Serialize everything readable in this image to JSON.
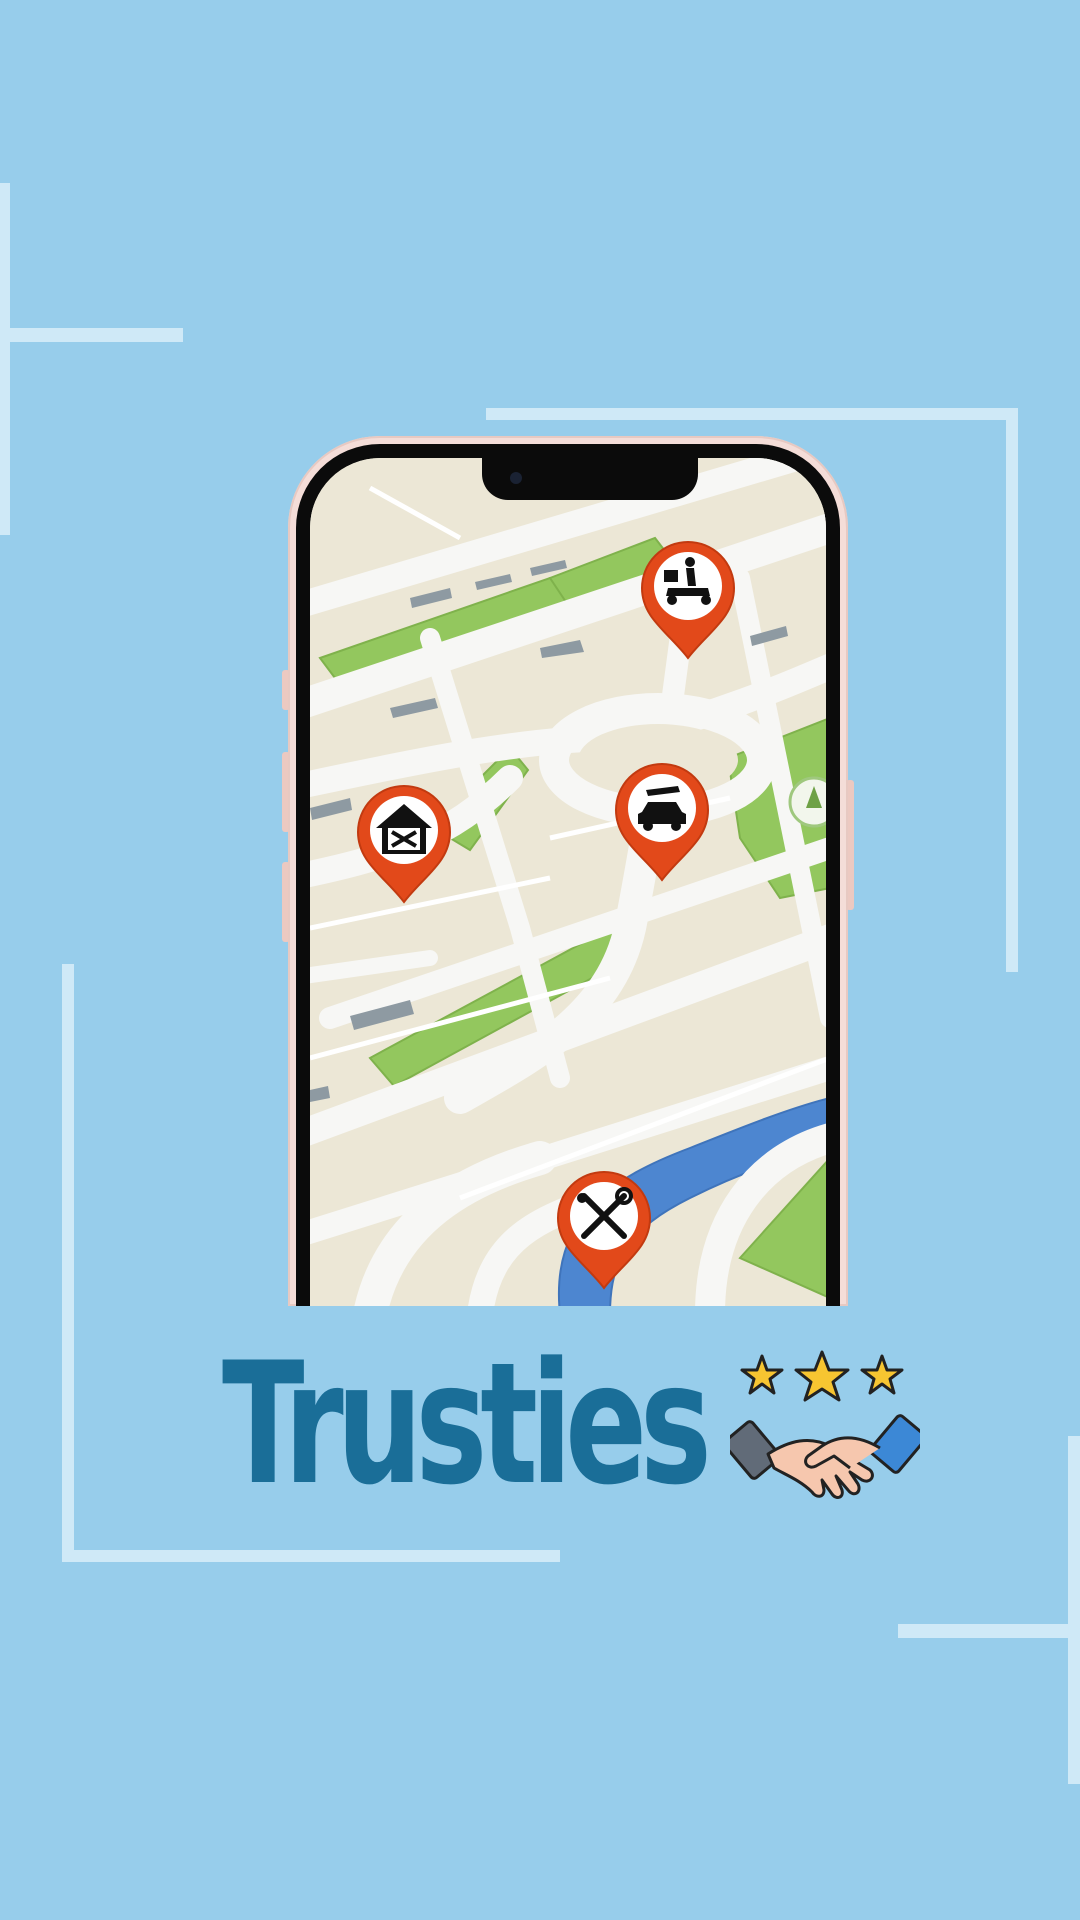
{
  "app": {
    "brand_name": "Trusties",
    "logo_icon": "handshake-stars-icon"
  },
  "colors": {
    "background": "#97cdeb",
    "brand_text": "#1a6e98",
    "pin": "#e2491a",
    "park": "#93c75e",
    "water": "#4d86d0",
    "road": "#f7f7f5",
    "block": "#ece7d6"
  },
  "map": {
    "pins": [
      {
        "name": "delivery-pin",
        "icon": "scooter-delivery-icon"
      },
      {
        "name": "home-repair-pin",
        "icon": "house-tools-icon"
      },
      {
        "name": "car-service-pin",
        "icon": "car-wrench-icon"
      },
      {
        "name": "repair-tools-pin",
        "icon": "wrench-screwdriver-icon"
      }
    ]
  }
}
